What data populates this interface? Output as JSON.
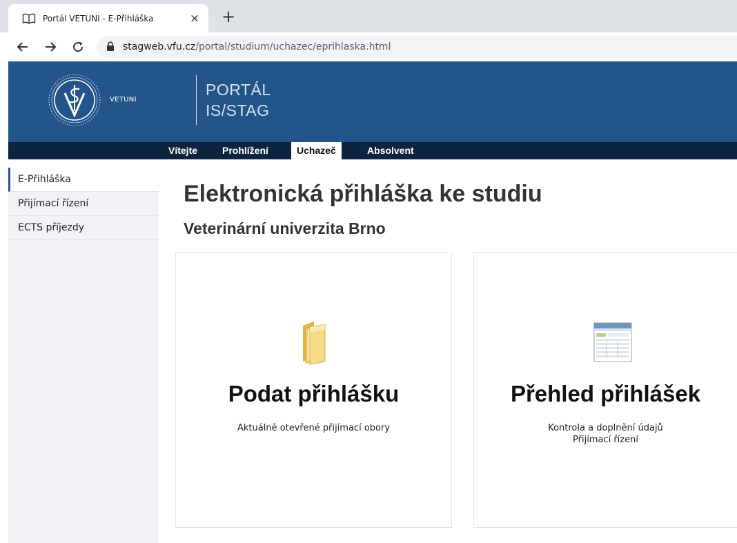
{
  "browser": {
    "tab_title": "Portál VETUNI - E-Přihláška",
    "tab_close": "×",
    "new_tab": "+",
    "url_host": "stagweb.vfu.cz",
    "url_path": "/portal/studium/uchazec/eprihlaska.html"
  },
  "header": {
    "logo_text": "VETUNI",
    "portal_line1": "PORTÁL",
    "portal_line2": "IS/STAG",
    "brand_color": "#23558b",
    "nav_color": "#0c2440"
  },
  "nav": {
    "items": [
      {
        "label": "Vítejte",
        "active": false
      },
      {
        "label": "Prohlížení",
        "active": false
      },
      {
        "label": "Uchazeč",
        "active": true
      },
      {
        "label": "Absolvent",
        "active": false
      }
    ]
  },
  "sidebar": {
    "items": [
      {
        "label": "E-Přihláška",
        "active": true
      },
      {
        "label": "Přijímací řízení",
        "active": false
      },
      {
        "label": "ECTS příjezdy",
        "active": false
      }
    ]
  },
  "main": {
    "title": "Elektronická přihláška ke studiu",
    "subtitle": "Veterinární univerzita Brno",
    "cards": [
      {
        "icon": "folder-icon",
        "title": "Podat přihlášku",
        "lines": [
          "Aktuálně otevřené přijímací obory"
        ]
      },
      {
        "icon": "spreadsheet-icon",
        "title": "Přehled přihlášek",
        "lines": [
          "Kontrola a doplnění údajů",
          "Přijímací řízení"
        ]
      }
    ]
  }
}
